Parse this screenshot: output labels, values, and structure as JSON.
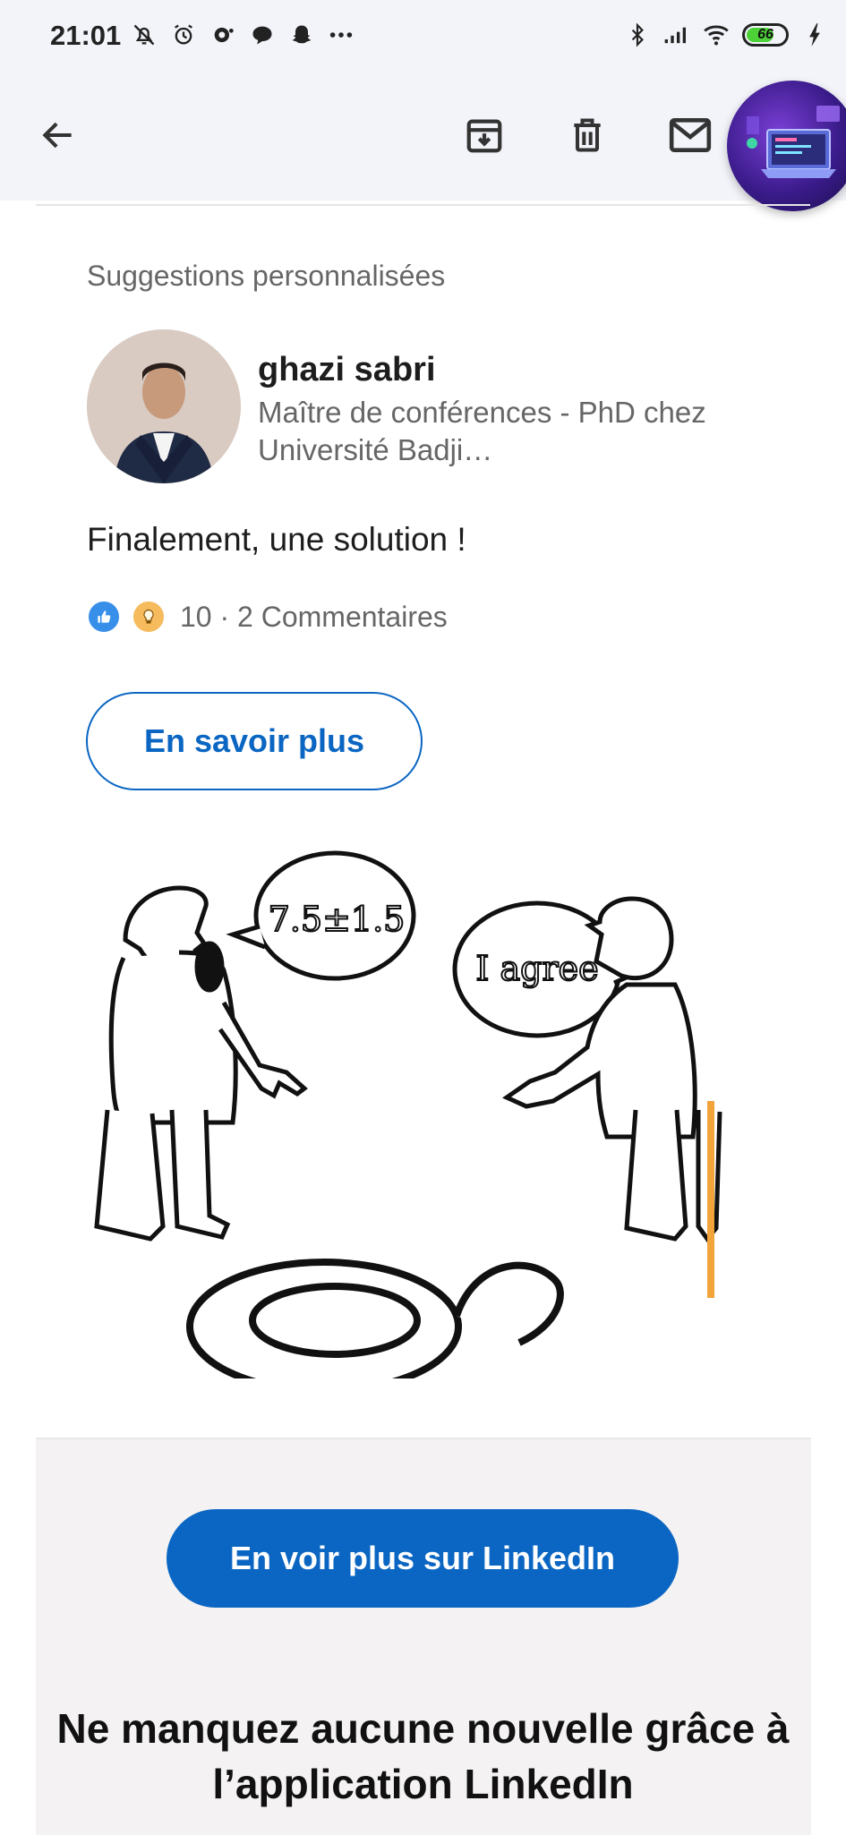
{
  "status_bar": {
    "time": "21:01",
    "left_icons": [
      "bell-off-icon",
      "alarm-icon",
      "notification-icon",
      "chat-bubble-icon",
      "snapchat-icon",
      "more-dots-icon"
    ],
    "right_icons": [
      "bluetooth-icon",
      "signal-icon",
      "wifi-icon",
      "battery-icon",
      "charging-icon"
    ],
    "battery_level": "66",
    "battery_fraction": 0.66
  },
  "toolbar": {
    "back_icon": "arrow-left-icon",
    "archive_icon": "archive-icon",
    "delete_icon": "trash-icon",
    "mail_icon": "mail-icon"
  },
  "post": {
    "section_label": "Suggestions personnalisées",
    "author_name": "ghazi sabri",
    "author_headline": "Maître de conférences - PhD chez Université Badji…",
    "text": "Finalement, une solution !",
    "reactions_summary": "10 · 2 Commentaires",
    "learn_more_label": "En savoir plus",
    "image": {
      "left_bubble": "7.5±1.5",
      "right_bubble": "I agree"
    }
  },
  "promo": {
    "cta_label": "En voir plus sur LinkedIn",
    "title": "Ne manquez aucune nouvelle grâce à l’application LinkedIn"
  },
  "colors": {
    "brand_blue": "#0a66c2",
    "bar_bg": "#f3f4fa",
    "promo_bg": "#f4f2f2"
  }
}
